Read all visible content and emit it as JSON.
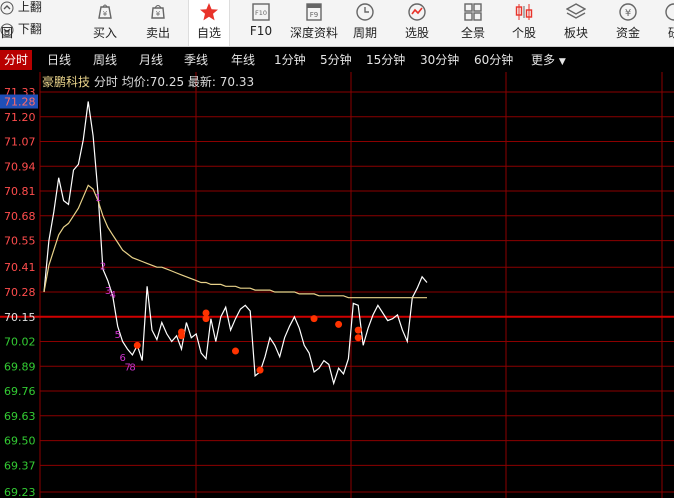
{
  "toolbar": {
    "page_up": "上翻",
    "page_down": "下翻",
    "back_fragment": "回",
    "buttons": [
      {
        "label": "买入",
        "icon": "buy-icon"
      },
      {
        "label": "卖出",
        "icon": "sell-icon"
      },
      {
        "label": "自选",
        "icon": "star-icon"
      },
      {
        "label": "F10",
        "icon": "f10-icon"
      },
      {
        "label": "深度资料",
        "icon": "f9-icon"
      },
      {
        "label": "周期",
        "icon": "clock-icon"
      },
      {
        "label": "选股",
        "icon": "stock-picker-icon"
      },
      {
        "label": "全景",
        "icon": "grid-icon"
      },
      {
        "label": "个股",
        "icon": "candlestick-icon"
      },
      {
        "label": "板块",
        "icon": "layers-icon"
      },
      {
        "label": "资金",
        "icon": "yen-icon"
      },
      {
        "label": "研",
        "icon": "research-icon"
      }
    ],
    "icon_texts": {
      "f10": "F10",
      "f9": "F9",
      "yen": "¥"
    }
  },
  "period_tabs": [
    "分时",
    "日线",
    "周线",
    "月线",
    "季线",
    "年线",
    "1分钟",
    "5分钟",
    "15分钟",
    "30分钟",
    "60分钟",
    "更多"
  ],
  "active_tab": "分时",
  "info": {
    "stock_name": "豪鹏科技",
    "mode": "分时",
    "avg_label": "均价:",
    "avg_value": "70.25",
    "last_label": "最新:",
    "last_value": "70.33"
  },
  "colors": {
    "price_line": "#ffffff",
    "avg_line": "#e8d28a",
    "grid": "#8b0000",
    "prev_close_line": "#d00000",
    "up_label": "#ff4d4d",
    "down_label": "#33cc33",
    "marker": "#ff3300",
    "wave_label": "#cc33cc",
    "active_tab_bg": "#b80000"
  },
  "chart_data": {
    "type": "line",
    "y_ticks": [
      "71.33",
      "71.20",
      "71.07",
      "70.94",
      "70.81",
      "70.68",
      "70.55",
      "70.41",
      "70.28",
      "70.15",
      "70.02",
      "69.89",
      "69.76",
      "69.63",
      "69.50",
      "69.37",
      "69.23"
    ],
    "y_highlight": "71.28",
    "ylim": [
      69.23,
      71.33
    ],
    "prev_close": 70.15,
    "series": [
      {
        "key": "price",
        "values": [
          70.28,
          70.55,
          70.7,
          70.88,
          70.76,
          70.74,
          70.92,
          70.95,
          71.08,
          71.28,
          71.1,
          70.8,
          70.4,
          70.34,
          70.26,
          70.1,
          70.02,
          69.98,
          69.95,
          70.0,
          69.92,
          70.31,
          70.08,
          70.03,
          70.12,
          70.06,
          70.02,
          70.05,
          69.98,
          70.12,
          70.04,
          70.06,
          69.96,
          69.93,
          70.14,
          70.02,
          70.15,
          70.2,
          70.08,
          70.14,
          70.19,
          70.21,
          70.18,
          69.84,
          69.86,
          69.94,
          70.04,
          70.0,
          69.94,
          70.04,
          70.1,
          70.15,
          70.09,
          70.0,
          69.96,
          69.86,
          69.88,
          69.92,
          69.9,
          69.8,
          69.88,
          69.85,
          69.93,
          70.22,
          70.21,
          70.0,
          70.09,
          70.16,
          70.21,
          70.17,
          70.13,
          70.14,
          70.16,
          70.08,
          70.02,
          70.25,
          70.3,
          70.36,
          70.33
        ]
      },
      {
        "key": "avg",
        "values": [
          70.28,
          70.42,
          70.5,
          70.58,
          70.62,
          70.64,
          70.68,
          70.72,
          70.78,
          70.84,
          70.82,
          70.76,
          70.68,
          70.62,
          70.58,
          70.54,
          70.5,
          70.48,
          70.46,
          70.45,
          70.44,
          70.43,
          70.42,
          70.41,
          70.41,
          70.4,
          70.39,
          70.38,
          70.37,
          70.36,
          70.35,
          70.34,
          70.33,
          70.33,
          70.32,
          70.32,
          70.32,
          70.31,
          70.31,
          70.31,
          70.3,
          70.3,
          70.3,
          70.29,
          70.29,
          70.29,
          70.29,
          70.28,
          70.28,
          70.28,
          70.28,
          70.28,
          70.27,
          70.27,
          70.27,
          70.27,
          70.26,
          70.26,
          70.26,
          70.26,
          70.26,
          70.26,
          70.25,
          70.25,
          70.25,
          70.25,
          70.25,
          70.25,
          70.25,
          70.25,
          70.25,
          70.25,
          70.25,
          70.25,
          70.25,
          70.25,
          70.25,
          70.25,
          70.25
        ]
      }
    ],
    "wave_labels": [
      {
        "text": "1",
        "i": 11,
        "y": 70.78
      },
      {
        "text": "2",
        "i": 12,
        "y": 70.42
      },
      {
        "text": "3",
        "i": 13,
        "y": 70.29
      },
      {
        "text": "4",
        "i": 14,
        "y": 70.27
      },
      {
        "text": "5",
        "i": 15,
        "y": 70.06
      },
      {
        "text": "6",
        "i": 16,
        "y": 69.94
      },
      {
        "text": "7",
        "i": 17,
        "y": 69.89
      },
      {
        "text": "8",
        "i": 18,
        "y": 69.89
      }
    ],
    "markers": [
      {
        "i": 19,
        "y": 70.0
      },
      {
        "i": 28,
        "y": 70.07
      },
      {
        "i": 28,
        "y": 70.05
      },
      {
        "i": 33,
        "y": 70.17
      },
      {
        "i": 33,
        "y": 70.14
      },
      {
        "i": 39,
        "y": 69.97
      },
      {
        "i": 44,
        "y": 69.87
      },
      {
        "i": 55,
        "y": 70.14
      },
      {
        "i": 60,
        "y": 70.11
      },
      {
        "i": 64,
        "y": 70.08
      },
      {
        "i": 64,
        "y": 70.04
      }
    ]
  }
}
